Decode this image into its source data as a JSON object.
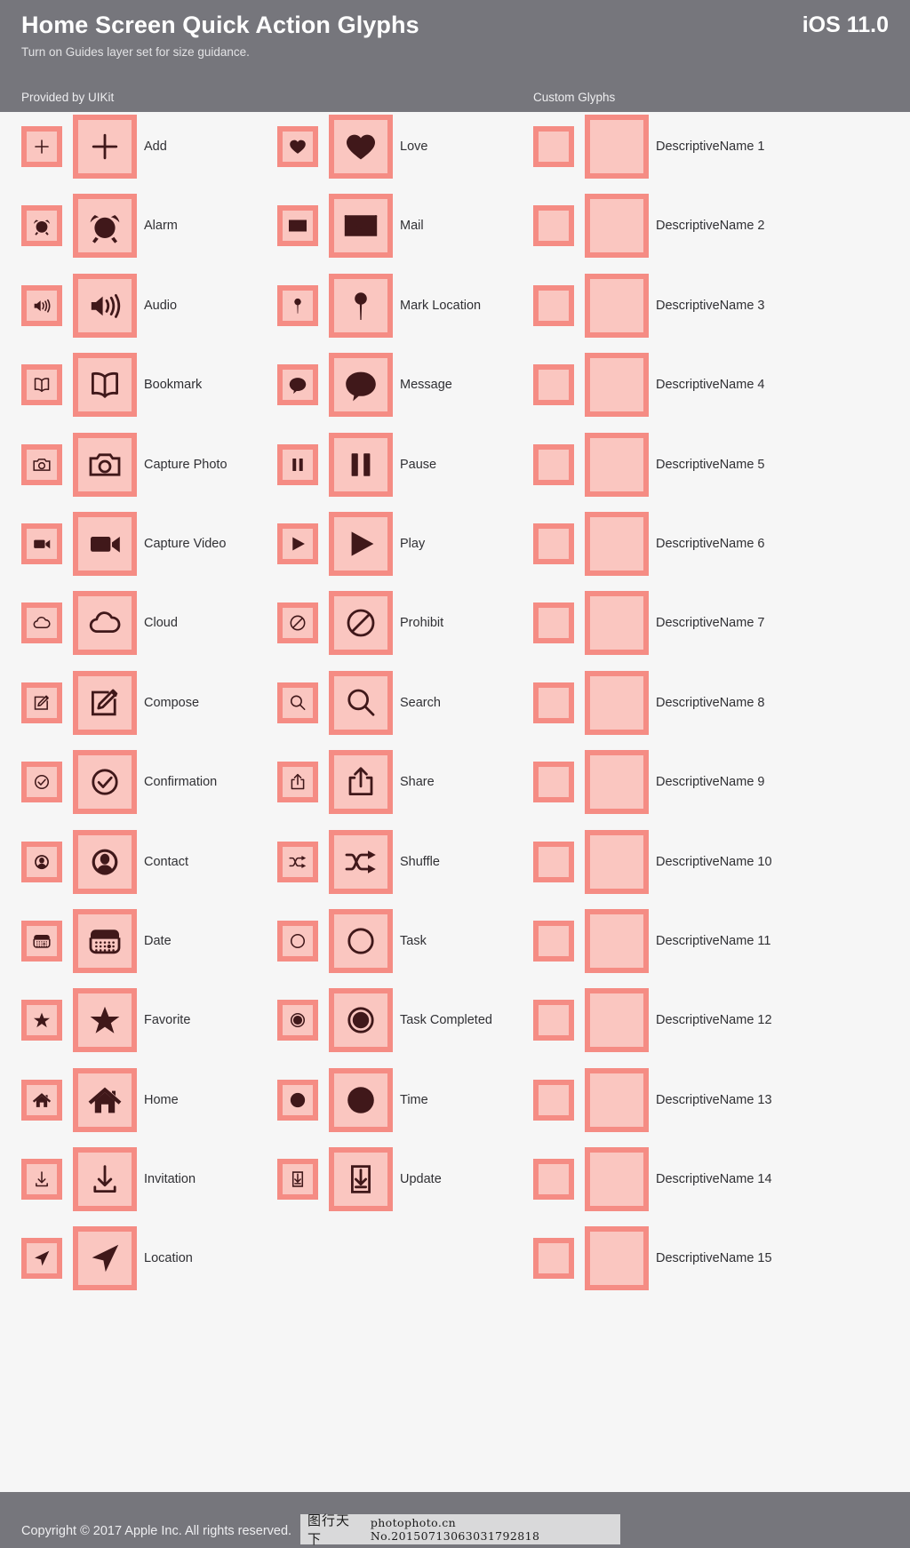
{
  "header": {
    "title": "Home Screen Quick Action Glyphs",
    "version": "iOS 11.0",
    "subtitle": "Turn on Guides layer set for size guidance.",
    "section_uikit": "Provided by UIKit",
    "section_custom": "Custom Glyphs"
  },
  "footer": {
    "copyright": "Copyright © 2017 Apple Inc. All rights reserved.",
    "watermark_cn": "图行天下",
    "watermark_en": "photophoto.cn   No.20150713063031792818"
  },
  "colors": {
    "header_bg": "#76767c",
    "page_bg": "#f6f6f6",
    "box_border": "#f58c84",
    "box_fill": "#fac6c0",
    "glyph": "#40181a",
    "label_text": "#303034",
    "header_text": "#ffffff"
  },
  "columns": [
    {
      "id": "col-1",
      "section": "Provided by UIKit",
      "rows": [
        {
          "label": "Add",
          "icon": "add-icon"
        },
        {
          "label": "Alarm",
          "icon": "alarm-icon"
        },
        {
          "label": "Audio",
          "icon": "audio-icon"
        },
        {
          "label": "Bookmark",
          "icon": "bookmark-icon"
        },
        {
          "label": "Capture Photo",
          "icon": "capture-photo-icon"
        },
        {
          "label": "Capture Video",
          "icon": "capture-video-icon"
        },
        {
          "label": "Cloud",
          "icon": "cloud-icon"
        },
        {
          "label": "Compose",
          "icon": "compose-icon"
        },
        {
          "label": "Confirmation",
          "icon": "confirmation-icon"
        },
        {
          "label": "Contact",
          "icon": "contact-icon"
        },
        {
          "label": "Date",
          "icon": "date-icon"
        },
        {
          "label": "Favorite",
          "icon": "favorite-icon"
        },
        {
          "label": "Home",
          "icon": "home-icon"
        },
        {
          "label": "Invitation",
          "icon": "invitation-icon"
        },
        {
          "label": "Location",
          "icon": "location-icon"
        }
      ]
    },
    {
      "id": "col-2",
      "section": "Provided by UIKit",
      "rows": [
        {
          "label": "Love",
          "icon": "love-icon"
        },
        {
          "label": "Mail",
          "icon": "mail-icon"
        },
        {
          "label": "Mark Location",
          "icon": "mark-location-icon"
        },
        {
          "label": "Message",
          "icon": "message-icon"
        },
        {
          "label": "Pause",
          "icon": "pause-icon"
        },
        {
          "label": "Play",
          "icon": "play-icon"
        },
        {
          "label": "Prohibit",
          "icon": "prohibit-icon"
        },
        {
          "label": "Search",
          "icon": "search-icon"
        },
        {
          "label": "Share",
          "icon": "share-icon"
        },
        {
          "label": "Shuffle",
          "icon": "shuffle-icon"
        },
        {
          "label": "Task",
          "icon": "task-icon"
        },
        {
          "label": "Task Completed",
          "icon": "task-completed-icon"
        },
        {
          "label": "Time",
          "icon": "time-icon"
        },
        {
          "label": "Update",
          "icon": "update-icon"
        }
      ]
    },
    {
      "id": "col-3",
      "section": "Custom Glyphs",
      "rows": [
        {
          "label": "DescriptiveName 1",
          "icon": "empty-glyph"
        },
        {
          "label": "DescriptiveName 2",
          "icon": "empty-glyph"
        },
        {
          "label": "DescriptiveName 3",
          "icon": "empty-glyph"
        },
        {
          "label": "DescriptiveName 4",
          "icon": "empty-glyph"
        },
        {
          "label": "DescriptiveName 5",
          "icon": "empty-glyph"
        },
        {
          "label": "DescriptiveName 6",
          "icon": "empty-glyph"
        },
        {
          "label": "DescriptiveName 7",
          "icon": "empty-glyph"
        },
        {
          "label": "DescriptiveName 8",
          "icon": "empty-glyph"
        },
        {
          "label": "DescriptiveName 9",
          "icon": "empty-glyph"
        },
        {
          "label": "DescriptiveName 10",
          "icon": "empty-glyph"
        },
        {
          "label": "DescriptiveName 11",
          "icon": "empty-glyph"
        },
        {
          "label": "DescriptiveName 12",
          "icon": "empty-glyph"
        },
        {
          "label": "DescriptiveName 13",
          "icon": "empty-glyph"
        },
        {
          "label": "DescriptiveName 14",
          "icon": "empty-glyph"
        },
        {
          "label": "DescriptiveName 15",
          "icon": "empty-glyph"
        }
      ]
    }
  ]
}
